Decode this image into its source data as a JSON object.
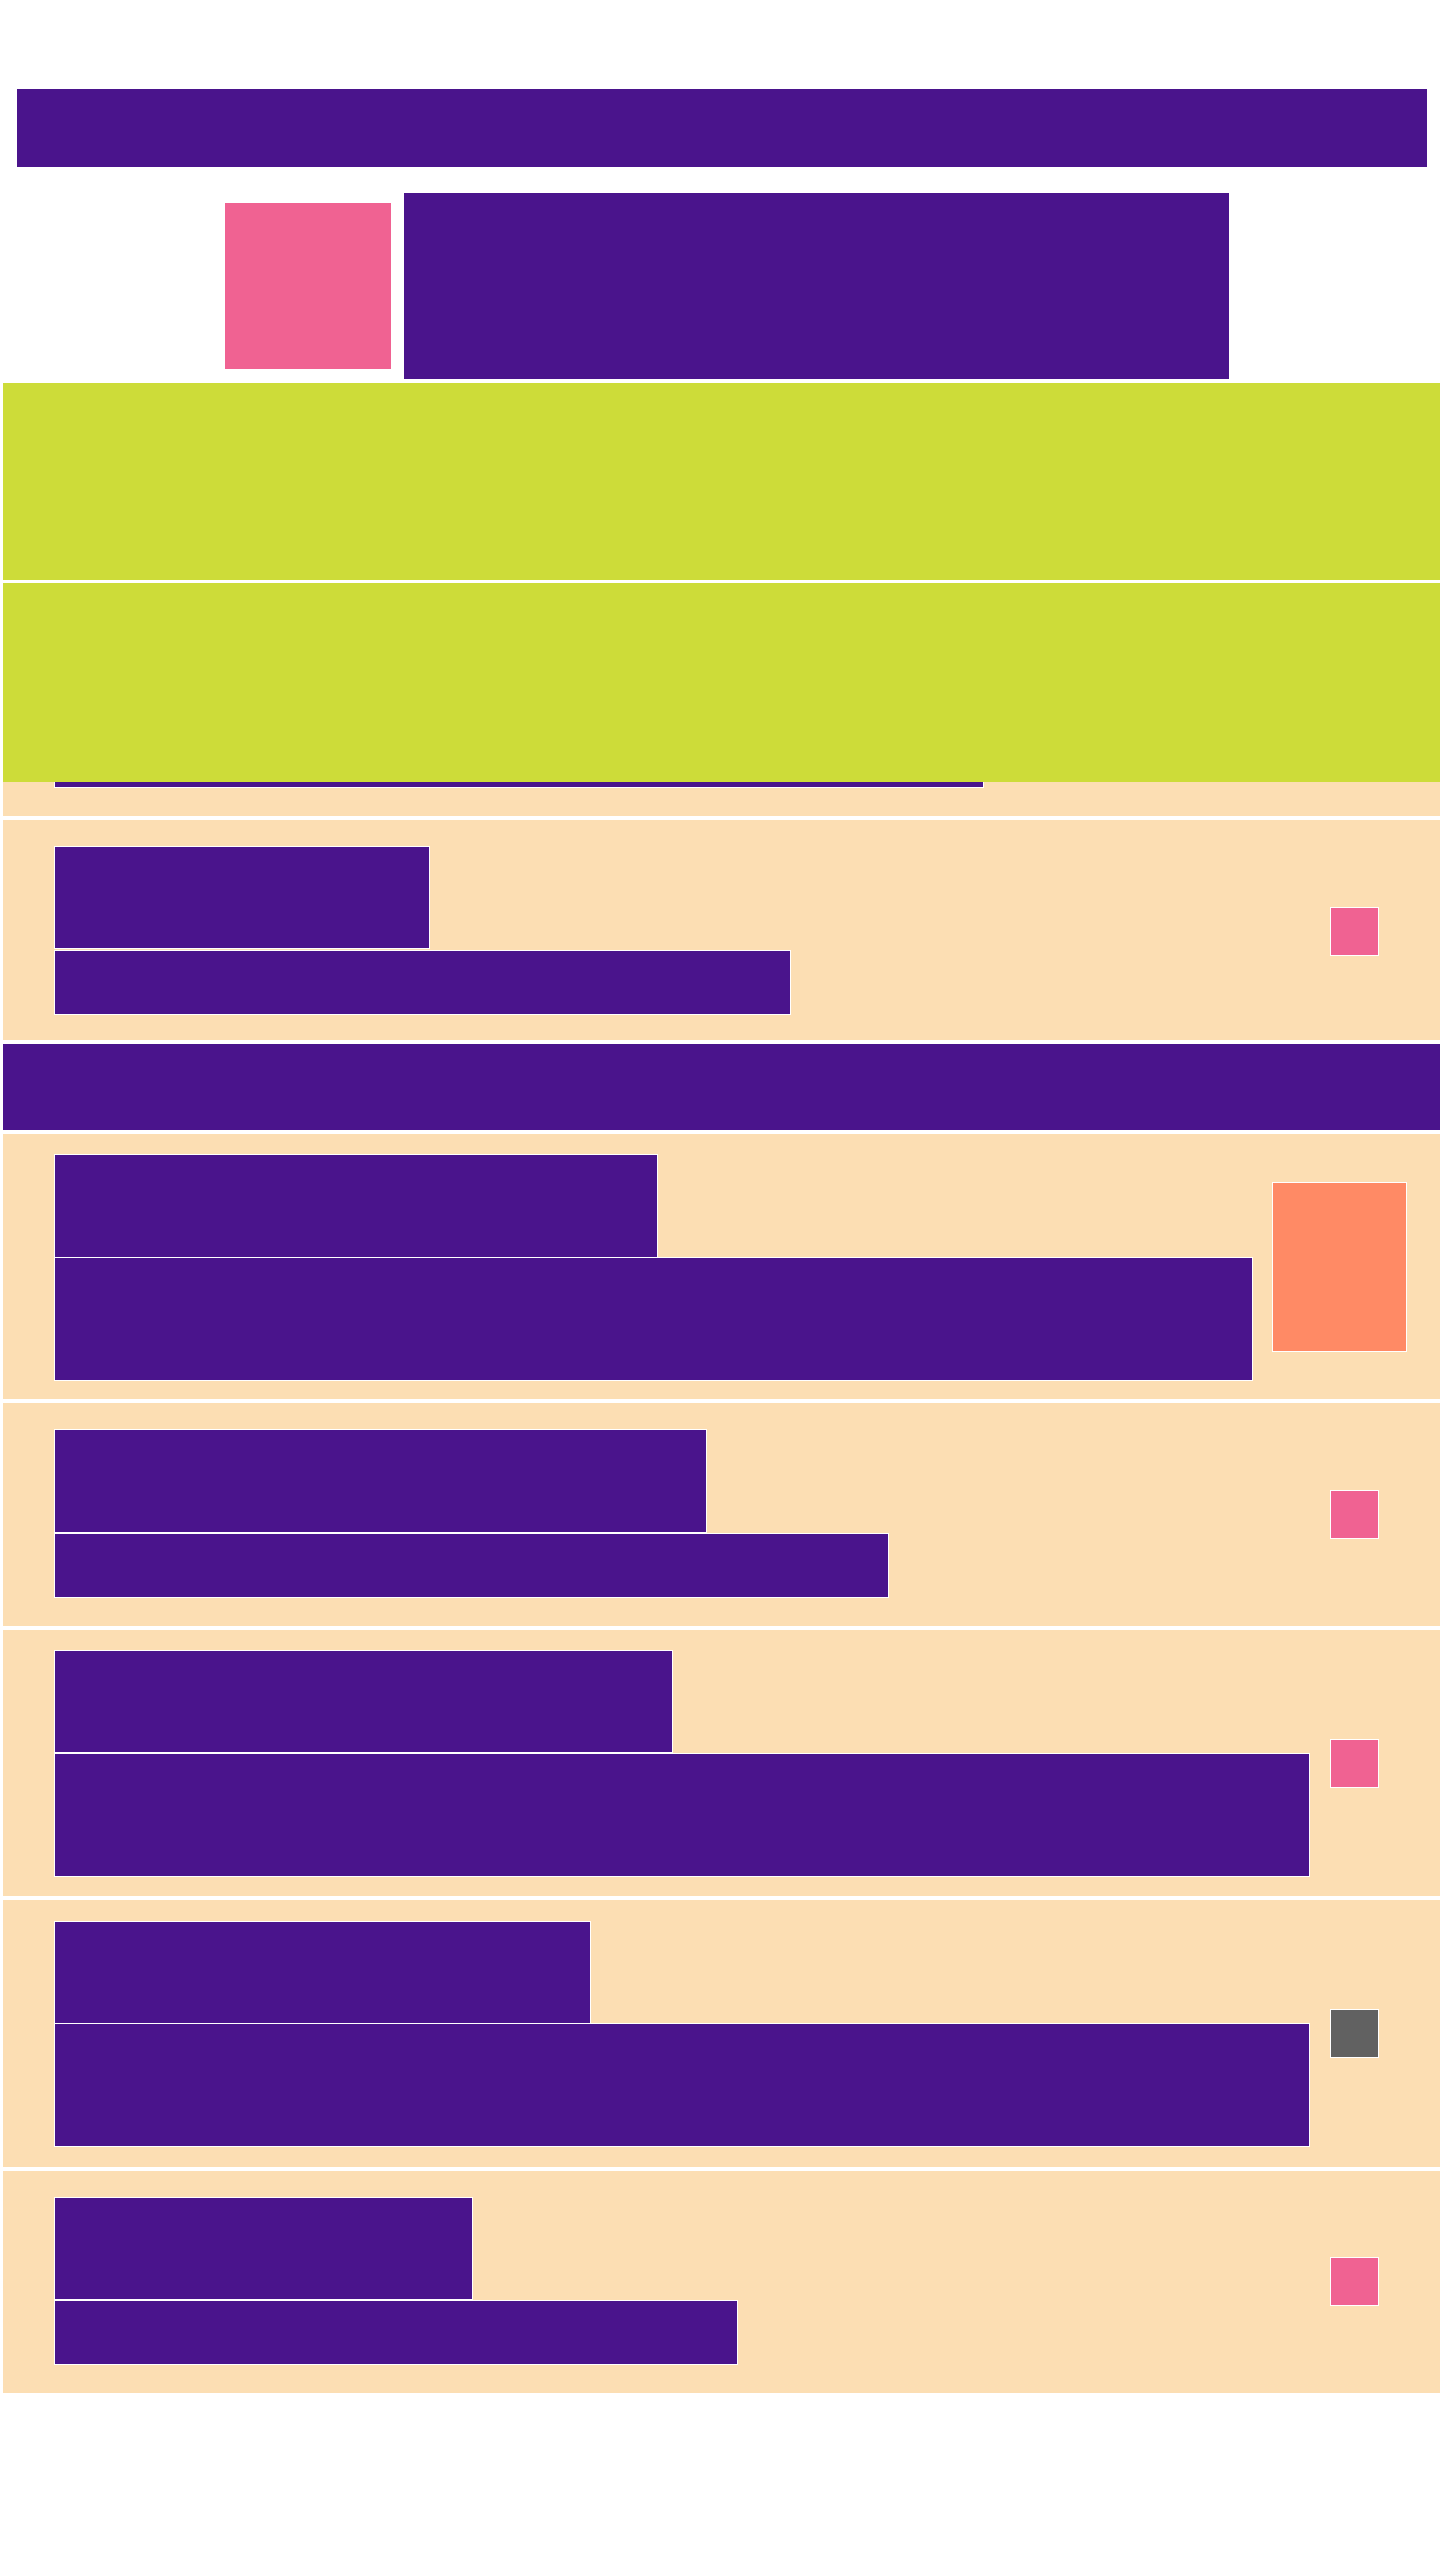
{
  "page": {
    "background": "#ffffff"
  },
  "colors": {
    "primary": "#4a148c",
    "accent": "#f06292",
    "highlight": "#cddc39",
    "card": "#fcdeb3",
    "orange": "#ff8a65",
    "gray": "#616161"
  },
  "header": {
    "title": "",
    "logo_icon": "logo-icon",
    "subtitle": ""
  },
  "banners": [
    {
      "label": ""
    },
    {
      "label": ""
    }
  ],
  "section_header": {
    "label": ""
  },
  "list": {
    "items": [
      {
        "title": "",
        "subtitle": "",
        "badge": "status-badge",
        "badge_color": "#f06292"
      },
      {
        "title": "",
        "subtitle": "",
        "badge": "thumbnail",
        "badge_color": "#ff8a65"
      },
      {
        "title": "",
        "subtitle": "",
        "badge": "status-badge",
        "badge_color": "#f06292"
      },
      {
        "title": "",
        "subtitle": "",
        "badge": "status-badge",
        "badge_color": "#f06292"
      },
      {
        "title": "",
        "subtitle": "",
        "badge": "status-badge",
        "badge_color": "#616161"
      },
      {
        "title": "",
        "subtitle": "",
        "badge": "status-badge",
        "badge_color": "#f06292"
      }
    ]
  }
}
